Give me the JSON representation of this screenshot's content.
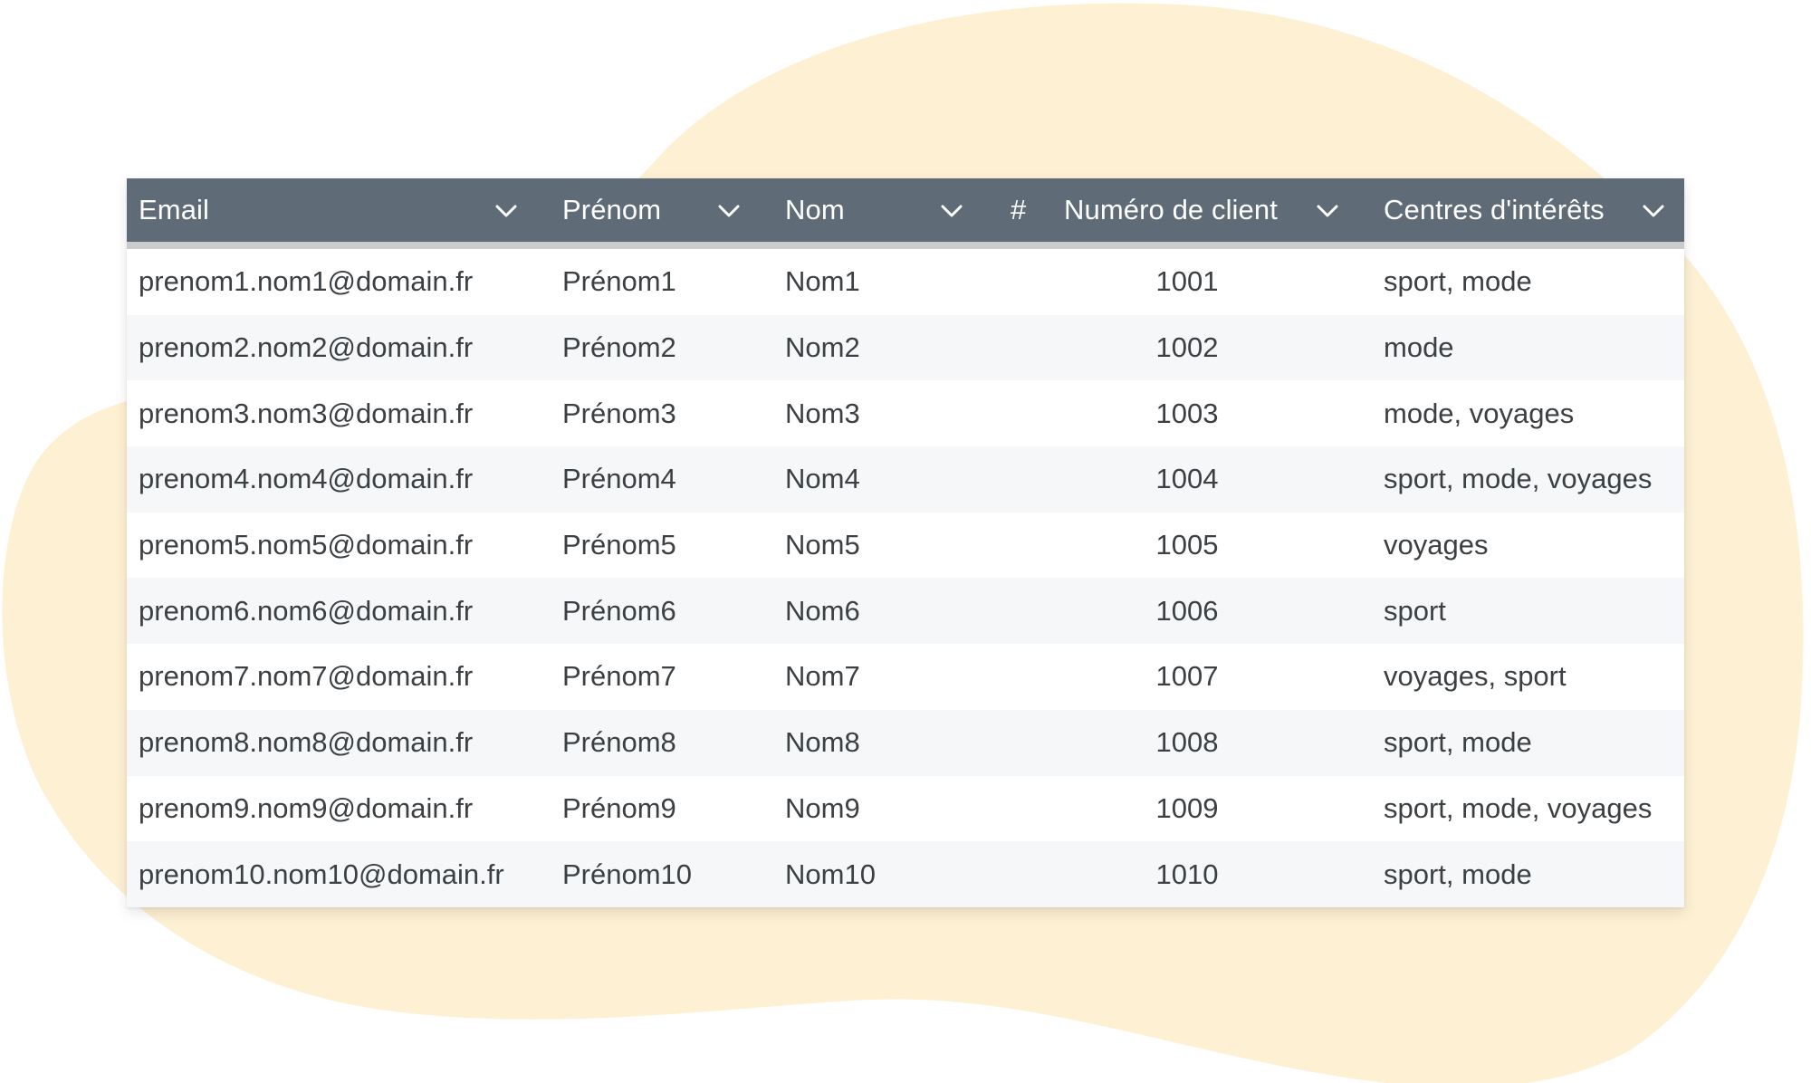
{
  "colors": {
    "blob": "#fdf0d3",
    "header_bg": "#5f6b76",
    "header_text": "#ffffff",
    "row_alt": "#f5f7f9",
    "cell_text": "#3c4043"
  },
  "table": {
    "headers": {
      "email": "Email",
      "prenom": "Prénom",
      "nom": "Nom",
      "numeric_marker": "#",
      "numero": "Numéro de client",
      "centres": "Centres d'intérêts"
    },
    "header_icons": {
      "sort": "chevron-down-icon"
    },
    "rows": [
      {
        "email": "prenom1.nom1@domain.fr",
        "prenom": "Prénom1",
        "nom": "Nom1",
        "numero": "1001",
        "centres": "sport, mode"
      },
      {
        "email": "prenom2.nom2@domain.fr",
        "prenom": "Prénom2",
        "nom": "Nom2",
        "numero": "1002",
        "centres": "mode"
      },
      {
        "email": "prenom3.nom3@domain.fr",
        "prenom": "Prénom3",
        "nom": "Nom3",
        "numero": "1003",
        "centres": "mode, voyages"
      },
      {
        "email": "prenom4.nom4@domain.fr",
        "prenom": "Prénom4",
        "nom": "Nom4",
        "numero": "1004",
        "centres": "sport, mode, voyages"
      },
      {
        "email": "prenom5.nom5@domain.fr",
        "prenom": "Prénom5",
        "nom": "Nom5",
        "numero": "1005",
        "centres": "voyages"
      },
      {
        "email": "prenom6.nom6@domain.fr",
        "prenom": "Prénom6",
        "nom": "Nom6",
        "numero": "1006",
        "centres": "sport"
      },
      {
        "email": "prenom7.nom7@domain.fr",
        "prenom": "Prénom7",
        "nom": "Nom7",
        "numero": "1007",
        "centres": "voyages, sport"
      },
      {
        "email": "prenom8.nom8@domain.fr",
        "prenom": "Prénom8",
        "nom": "Nom8",
        "numero": "1008",
        "centres": "sport, mode"
      },
      {
        "email": "prenom9.nom9@domain.fr",
        "prenom": "Prénom9",
        "nom": "Nom9",
        "numero": "1009",
        "centres": "sport, mode, voyages"
      },
      {
        "email": "prenom10.nom10@domain.fr",
        "prenom": "Prénom10",
        "nom": "Nom10",
        "numero": "1010",
        "centres": "sport, mode"
      }
    ]
  }
}
